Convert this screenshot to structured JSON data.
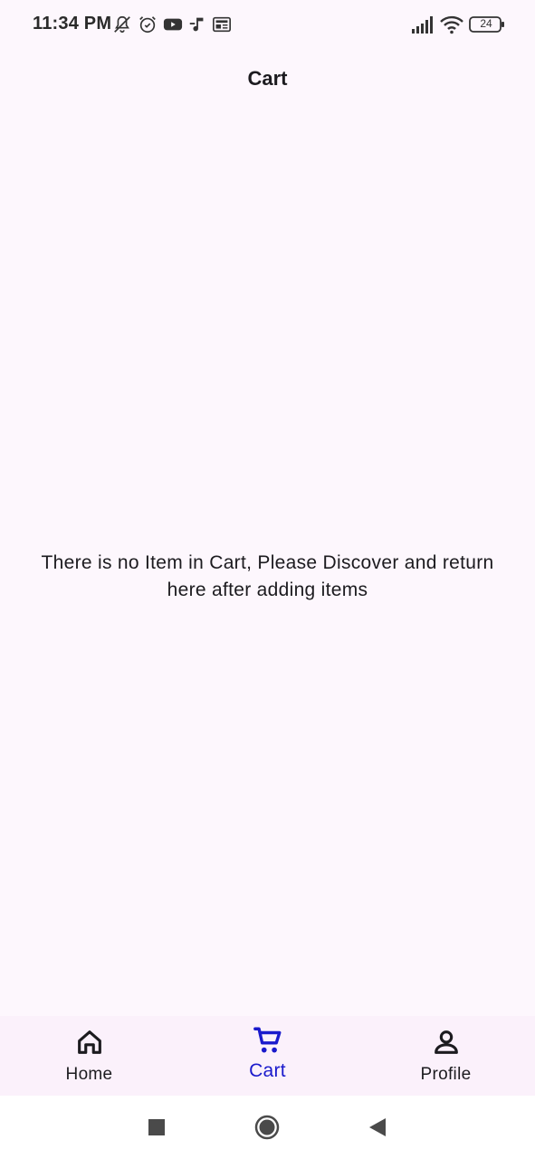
{
  "status_bar": {
    "time": "11:34 PM",
    "battery": "24",
    "icons": [
      "bell-off-icon",
      "alarm-icon",
      "youtube-icon",
      "music-icon",
      "news-icon",
      "signal-icon",
      "wifi-icon",
      "battery-icon"
    ]
  },
  "app_bar": {
    "title": "Cart"
  },
  "main": {
    "empty_message": "There is no Item in Cart, Please Discover and return here after adding items"
  },
  "bottom_nav": {
    "items": [
      {
        "label": "Home",
        "icon": "home-icon",
        "active": false
      },
      {
        "label": "Cart",
        "icon": "cart-icon",
        "active": true
      },
      {
        "label": "Profile",
        "icon": "person-icon",
        "active": false
      }
    ],
    "active_color": "#1a1acc"
  },
  "system_nav": {
    "buttons": [
      "recents-square-icon",
      "home-circle-icon",
      "back-triangle-icon"
    ]
  }
}
